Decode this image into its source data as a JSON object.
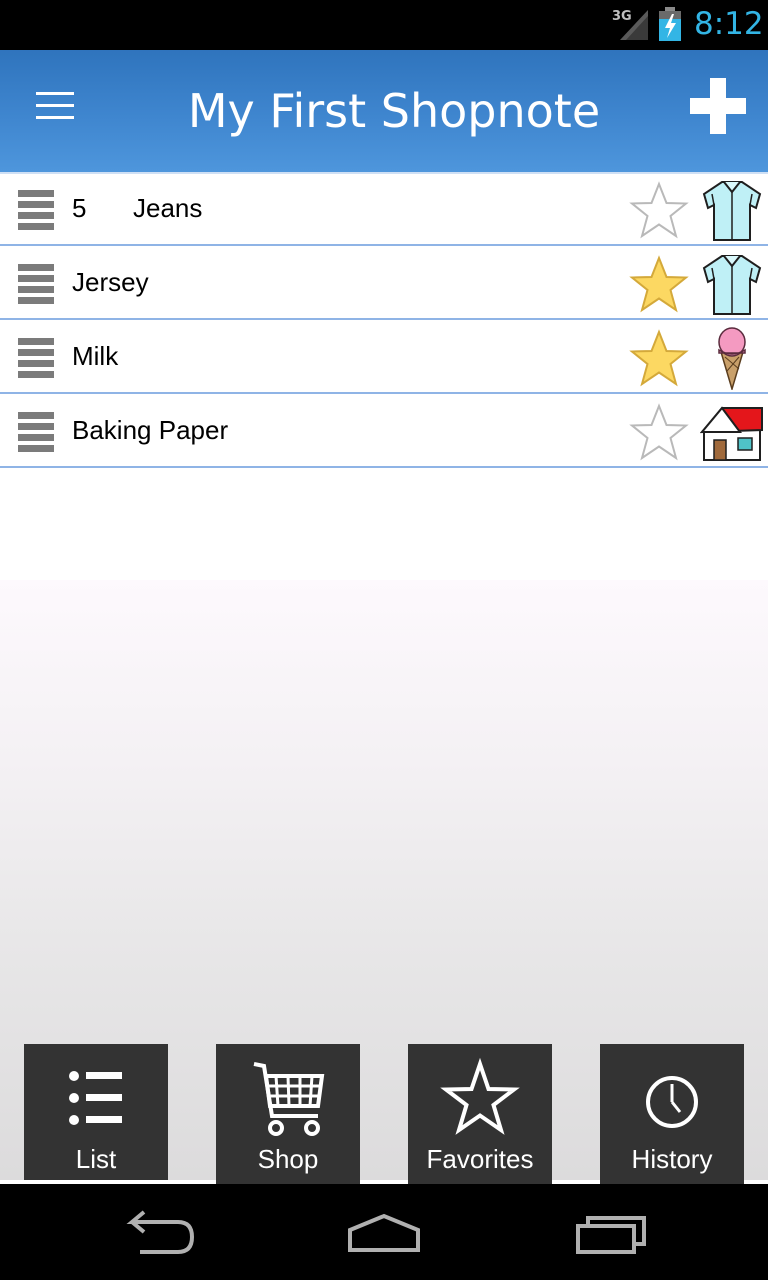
{
  "status_bar": {
    "network": "3G",
    "time": "8:12",
    "icons": [
      "signal-icon",
      "battery-charging-icon"
    ]
  },
  "action_bar": {
    "title": "My First Shopnote",
    "menu_icon": "hamburger-menu-icon",
    "add_icon": "plus-icon",
    "background_color": "#3f86cf"
  },
  "items": [
    {
      "quantity": "5",
      "name": "Jeans",
      "favorite": false,
      "category_icon": "shirt-icon"
    },
    {
      "quantity": "",
      "name": "Jersey",
      "favorite": true,
      "category_icon": "shirt-icon"
    },
    {
      "quantity": "",
      "name": "Milk",
      "favorite": true,
      "category_icon": "ice-cream-icon"
    },
    {
      "quantity": "",
      "name": "Baking Paper",
      "favorite": false,
      "category_icon": "house-icon"
    }
  ],
  "tabs": [
    {
      "label": "List",
      "icon": "list-icon",
      "selected": true
    },
    {
      "label": "Shop",
      "icon": "shopping-cart-icon",
      "selected": false
    },
    {
      "label": "Favorites",
      "icon": "star-outline-icon",
      "selected": false
    },
    {
      "label": "History",
      "icon": "clock-icon",
      "selected": false
    }
  ],
  "nav_bar": {
    "icons": [
      "back-icon",
      "home-icon",
      "recent-apps-icon"
    ]
  },
  "colors": {
    "star_filled": "#fcd862",
    "star_outline": "#b9b9b9",
    "tab_background": "#333333",
    "row_divider": "#8fb4e6"
  }
}
